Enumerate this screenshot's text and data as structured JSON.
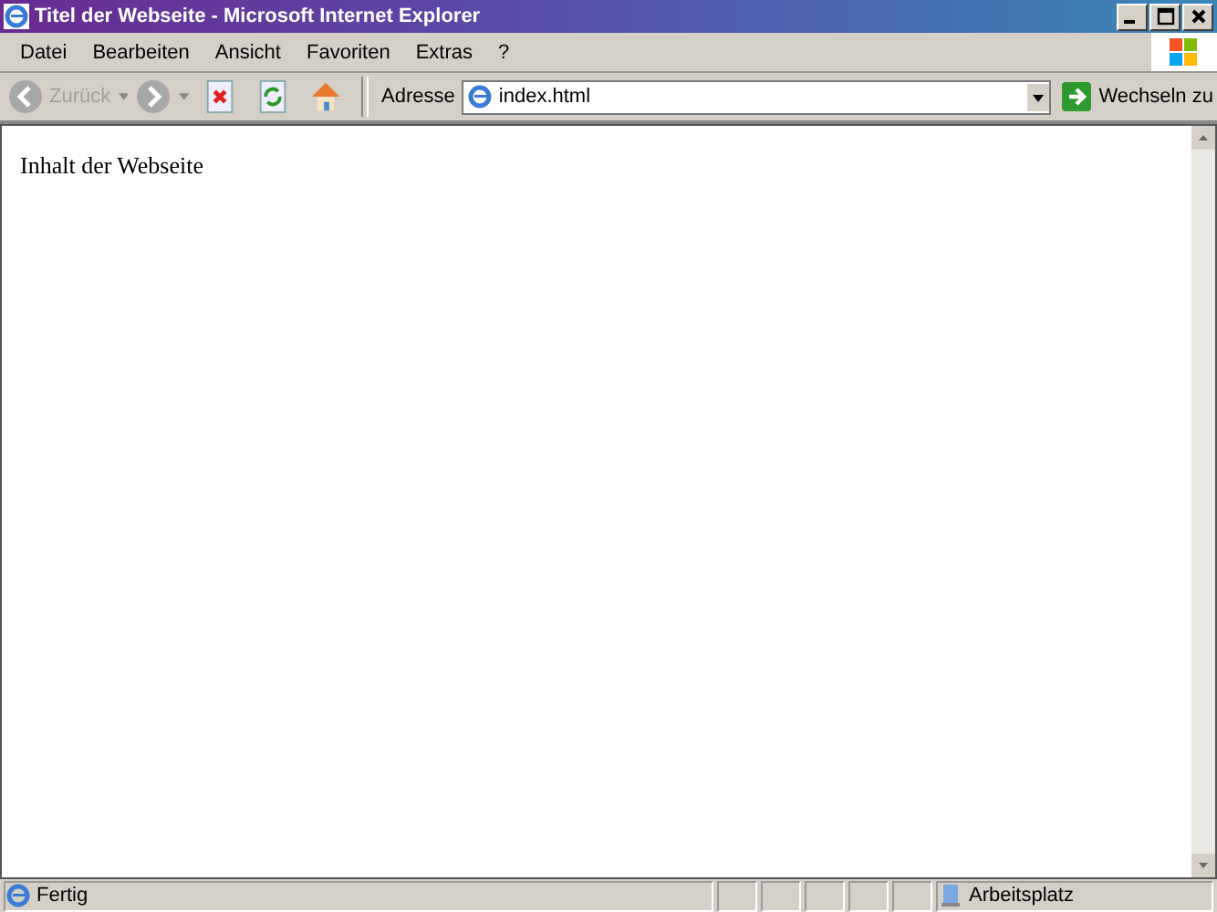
{
  "window": {
    "title": "Titel der Webseite - Microsoft Internet Explorer"
  },
  "menu": [
    "Datei",
    "Bearbeiten",
    "Ansicht",
    "Favoriten",
    "Extras",
    "?"
  ],
  "toolbar": {
    "back": {
      "label": "Zurück",
      "disabled": true
    },
    "forward": {
      "disabled": true
    }
  },
  "address": {
    "label": "Adresse",
    "value": "index.html",
    "go": "Wechseln zu"
  },
  "content": {
    "text": "Inhalt der Webseite"
  },
  "status_bar": {
    "text": "Fertig",
    "zone": "Arbeitsplatz"
  }
}
